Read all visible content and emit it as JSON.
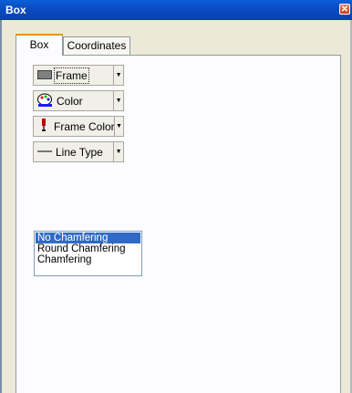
{
  "window": {
    "title": "Box",
    "close_glyph": "✕"
  },
  "tabs": [
    {
      "label": "Box",
      "active": true
    },
    {
      "label": "Coordinates",
      "active": false
    }
  ],
  "properties": [
    {
      "label": "Frame",
      "icon": "frame-rect-icon"
    },
    {
      "label": "Color",
      "icon": "palette-icon"
    },
    {
      "label": "Frame Color",
      "icon": "paint-brush-icon"
    },
    {
      "label": "Line Type",
      "icon": "line-icon"
    }
  ],
  "dropdown_arrow": "▼",
  "chamfer_list": {
    "items": [
      "No Chamfering",
      "Round Chamfering",
      "Chamfering"
    ],
    "selected": "No Chamfering"
  },
  "colors": {
    "selection": "#316ac5",
    "title_bar": "#0b4cc4",
    "tab_accent": "#e59700"
  }
}
